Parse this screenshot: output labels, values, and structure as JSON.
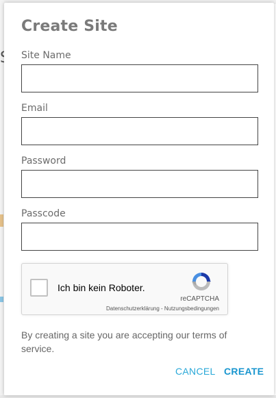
{
  "dialog": {
    "title": "Create Site",
    "fields": [
      {
        "label": "Site Name",
        "value": ""
      },
      {
        "label": "Email",
        "value": ""
      },
      {
        "label": "Password",
        "value": ""
      },
      {
        "label": "Passcode",
        "value": ""
      }
    ],
    "captcha": {
      "checkbox_label": "Ich bin kein Roboter.",
      "brand": "reCAPTCHA",
      "links": "Datenschutzerklärung - Nutzungsbedingungen",
      "icon": "recaptcha-icon"
    },
    "terms_text": "By creating a site you are accepting our terms of service.",
    "cancel_label": "CANCEL",
    "create_label": "CREATE"
  },
  "background": {
    "partial_char": "S"
  },
  "colors": {
    "accent": "#29a8d8",
    "title": "#7a7a7a",
    "field_border": "#444444"
  }
}
